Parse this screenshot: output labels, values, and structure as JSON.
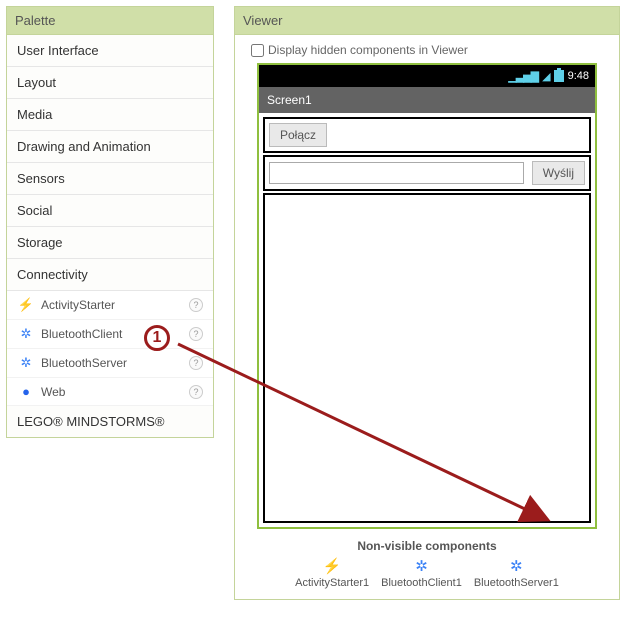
{
  "palette": {
    "title": "Palette",
    "categories": [
      "User Interface",
      "Layout",
      "Media",
      "Drawing and Animation",
      "Sensors",
      "Social",
      "Storage",
      "Connectivity"
    ],
    "connectivity_items": [
      {
        "icon": "⚡",
        "cls": "ic-light",
        "label": "ActivityStarter"
      },
      {
        "icon": "✲",
        "cls": "ic-bt",
        "label": "BluetoothClient"
      },
      {
        "icon": "✲",
        "cls": "ic-bt",
        "label": "BluetoothServer"
      },
      {
        "icon": "●",
        "cls": "ic-web",
        "label": "Web"
      }
    ],
    "lego_label": "LEGO® MINDSTORMS®"
  },
  "viewer": {
    "title": "Viewer",
    "hidden_checkbox_label": "Display hidden components in Viewer",
    "status_time": "9:48",
    "screen_title": "Screen1",
    "button_connect": "Połącz",
    "button_send": "Wyślij",
    "nonvis_title": "Non-visible components",
    "nonvis": [
      {
        "icon": "⚡",
        "cls": "ic-light",
        "label": "ActivityStarter1"
      },
      {
        "icon": "✲",
        "cls": "ic-bt",
        "label": "BluetoothClient1"
      },
      {
        "icon": "✲",
        "cls": "ic-bt",
        "label": "BluetoothServer1"
      }
    ]
  },
  "annotation": {
    "number": "1"
  }
}
